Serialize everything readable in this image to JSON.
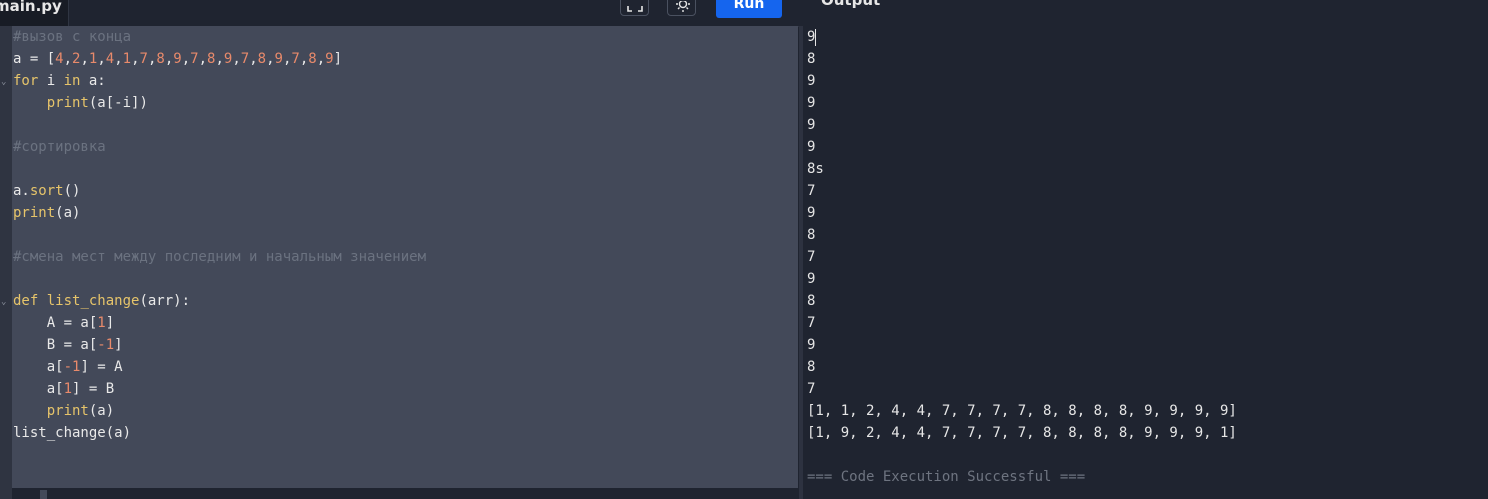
{
  "file_tab": {
    "name": "main.py"
  },
  "toolbar": {
    "fullscreen_icon": "fullscreen-icon",
    "theme_icon": "sun-icon",
    "run_label": "Run"
  },
  "output": {
    "title": "Output",
    "lines": [
      "9",
      "8",
      "9",
      "9",
      "9",
      "9",
      "8s",
      "7",
      "9",
      "8",
      "7",
      "9",
      "8",
      "7",
      "9",
      "8",
      "7",
      "[1, 1, 2, 4, 4, 7, 7, 7, 7, 8, 8, 8, 8, 9, 9, 9, 9]",
      "[1, 9, 2, 4, 4, 7, 7, 7, 7, 8, 8, 8, 8, 9, 9, 9, 1]",
      "",
      "=== Code Execution Successful ==="
    ]
  },
  "code": {
    "c1": "#вызов с конца",
    "l2": {
      "a": "a = [",
      "n1": "4",
      "s1": ",",
      "n2": "2",
      "s2": ",",
      "n3": "1",
      "s3": ",",
      "n4": "4",
      "s4": ",",
      "n5": "1",
      "s5": ",",
      "n6": "7",
      "s6": ",",
      "n7": "8",
      "s7": ",",
      "n8": "9",
      "s8": ",",
      "n9": "7",
      "s9": ",",
      "n10": "8",
      "s10": ",",
      "n11": "9",
      "s11": ",",
      "n12": "7",
      "s12": ",",
      "n13": "8",
      "s13": ",",
      "n14": "9",
      "s14": ",",
      "n15": "7",
      "s15": ",",
      "n16": "8",
      "s16": ",",
      "n17": "9",
      "end": "]"
    },
    "l3": {
      "for": "for",
      "i": " i ",
      "in": "in",
      "rest": " a:"
    },
    "l4": {
      "indent": "    ",
      "print": "print",
      "rest": "(a[-i])"
    },
    "c2": "#сортировка",
    "l7": {
      "a": "a.",
      "sort": "sort",
      "rest": "()"
    },
    "l8": {
      "print": "print",
      "rest": "(a)"
    },
    "c3": "#смена мест между последним и начальным значением",
    "l12": {
      "def": "def",
      "sp": " ",
      "name": "list_change",
      "rest": "(arr):"
    },
    "l13": {
      "a": "    A = a[",
      "n": "1",
      "b": "]"
    },
    "l14": {
      "a": "    B = a[",
      "n": "-1",
      "b": "]"
    },
    "l15": {
      "a": "    a[",
      "n": "-1",
      "b": "] = A"
    },
    "l16": {
      "a": "    a[",
      "n": "1",
      "b": "] = B"
    },
    "l17": {
      "indent": "    ",
      "print": "print",
      "rest": "(a)"
    },
    "l18": "list_change(a)"
  }
}
